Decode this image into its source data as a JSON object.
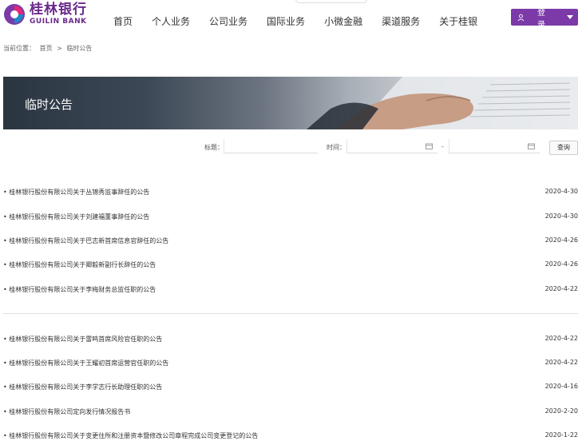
{
  "brand": {
    "name_cn": "桂林银行",
    "name_en": "GUILIN BANK"
  },
  "nav": {
    "items": [
      "首页",
      "个人业务",
      "公司业务",
      "国际业务",
      "小微金融",
      "渠道服务",
      "关于桂银"
    ]
  },
  "login": {
    "label": "登 录"
  },
  "breadcrumb": {
    "prefix": "当前位置：",
    "home": "首页",
    "sep": ">",
    "current": "临时公告"
  },
  "banner": {
    "title": "临时公告"
  },
  "search": {
    "title_label": "标题：",
    "time_label": "时间：",
    "dash": "-",
    "query_label": "查询"
  },
  "announcements": [
    {
      "title": "• 桂林银行股份有限公司关于丛锦秀监事辞任的公告",
      "date": "2020-4-30"
    },
    {
      "title": "• 桂林银行股份有限公司关于刘建福董事辞任的公告",
      "date": "2020-4-30"
    },
    {
      "title": "• 桂林银行股份有限公司关于巴志新首席信息官辞任的公告",
      "date": "2020-4-26"
    },
    {
      "title": "• 桂林银行股份有限公司关于卿毅新副行长辞任的公告",
      "date": "2020-4-26"
    },
    {
      "title": "• 桂林银行股份有限公司关于李梅财务总监任职的公告",
      "date": "2020-4-22"
    },
    {
      "title": "• 桂林银行股份有限公司关于雷鸣首席风险官任职的公告",
      "date": "2020-4-22"
    },
    {
      "title": "• 桂林银行股份有限公司关于王耀初首席运营官任职的公告",
      "date": "2020-4-22"
    },
    {
      "title": "• 桂林银行股份有限公司关于李学志行长助理任职的公告",
      "date": "2020-4-16"
    },
    {
      "title": "• 桂林银行股份有限公司定向发行情况报告书",
      "date": "2020-2-20"
    },
    {
      "title": "• 桂林银行股份有限公司关于变更住所和注册资本暨修改公司章程完成公司变更登记的公告",
      "date": "2020-1-22"
    }
  ],
  "colors": {
    "brand_purple": "#7b3aa8",
    "logo_purple": "#6a2a8c"
  }
}
